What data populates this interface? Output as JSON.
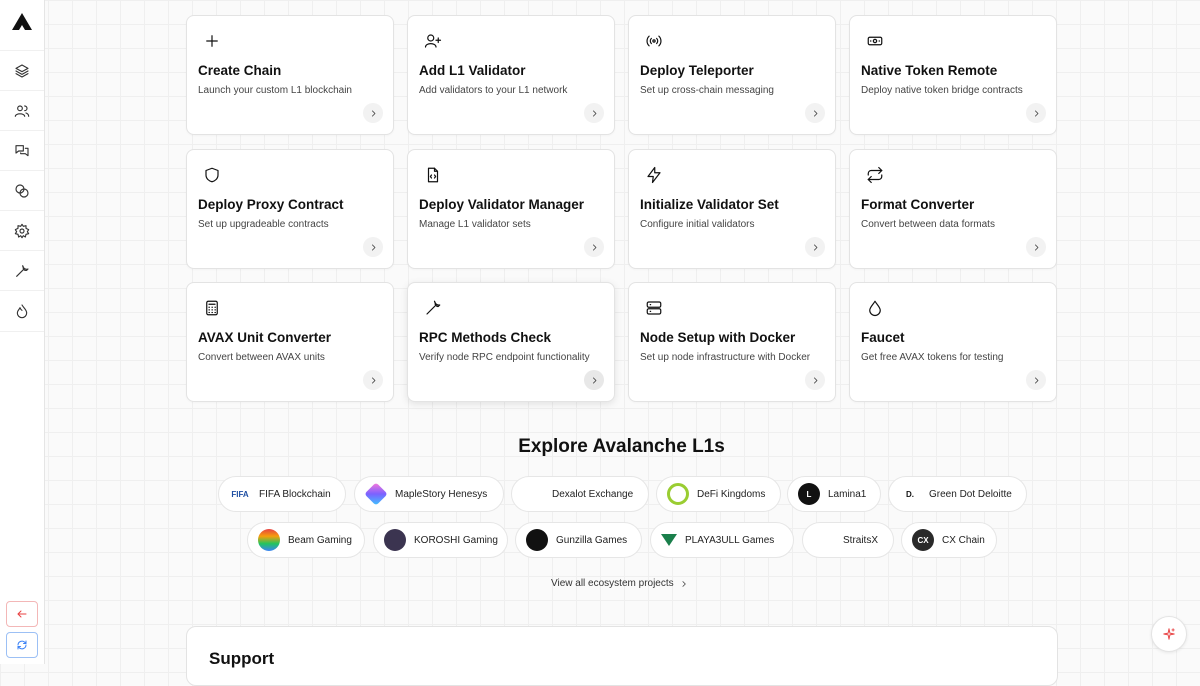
{
  "sidebar": {
    "logo_icon": "avalanche-logo",
    "items": [
      {
        "name": "layers-icon"
      },
      {
        "name": "users-icon"
      },
      {
        "name": "messages-icon"
      },
      {
        "name": "coins-icon"
      },
      {
        "name": "settings-gear-icon"
      },
      {
        "name": "wrench-icon"
      },
      {
        "name": "fire-icon"
      }
    ],
    "bottom_buttons": [
      {
        "name": "arrow-left-icon",
        "color": "#e84142"
      },
      {
        "name": "refresh-icon",
        "color": "#3b82f6"
      }
    ]
  },
  "tools": [
    {
      "title": "Create Chain",
      "desc": "Launch your custom L1 blockchain",
      "icon": "plus-icon"
    },
    {
      "title": "Add L1 Validator",
      "desc": "Add validators to your L1 network",
      "icon": "user-plus-icon"
    },
    {
      "title": "Deploy Teleporter",
      "desc": "Set up cross-chain messaging",
      "icon": "broadcast-icon"
    },
    {
      "title": "Native Token Remote",
      "desc": "Deploy native token bridge contracts",
      "icon": "banknote-icon"
    },
    {
      "title": "Deploy Proxy Contract",
      "desc": "Set up upgradeable contracts",
      "icon": "shield-icon"
    },
    {
      "title": "Deploy Validator Manager",
      "desc": "Manage L1 validator sets",
      "icon": "file-code-icon"
    },
    {
      "title": "Initialize Validator Set",
      "desc": "Configure initial validators",
      "icon": "lightning-icon"
    },
    {
      "title": "Format Converter",
      "desc": "Convert between data formats",
      "icon": "repeat-arrows-icon"
    },
    {
      "title": "AVAX Unit Converter",
      "desc": "Convert between AVAX units",
      "icon": "calculator-icon"
    },
    {
      "title": "RPC Methods Check",
      "desc": "Verify node RPC endpoint functionality",
      "icon": "wrench-icon"
    },
    {
      "title": "Node Setup with Docker",
      "desc": "Set up node infrastructure with Docker",
      "icon": "server-icon"
    },
    {
      "title": "Faucet",
      "desc": "Get free AVAX tokens for testing",
      "icon": "droplet-icon"
    }
  ],
  "explore": {
    "title": "Explore Avalanche L1s",
    "chains": [
      {
        "label": "FIFA Blockchain",
        "logo_text": "FIFA",
        "color": "#1f4fa3"
      },
      {
        "label": "MapleStory Henesys",
        "logo_text": "",
        "color": "#7b61ff"
      },
      {
        "label": "Dexalot Exchange",
        "logo_text": "",
        "color": "#d6336c"
      },
      {
        "label": "DeFi Kingdoms",
        "logo_text": "",
        "color": "#9acd32"
      },
      {
        "label": "Lamina1",
        "logo_text": "L",
        "color": "#111111"
      },
      {
        "label": "Green Dot Deloitte",
        "logo_text": "D.",
        "color": "#111111"
      },
      {
        "label": "Beam Gaming",
        "logo_text": "",
        "color": "#f59e0b"
      },
      {
        "label": "KOROSHI Gaming",
        "logo_text": "",
        "color": "#3b3450"
      },
      {
        "label": "Gunzilla Games",
        "logo_text": "",
        "color": "#111111"
      },
      {
        "label": "PLAYA3ULL Games",
        "logo_text": "",
        "color": "#1a7f4b"
      },
      {
        "label": "StraitsX",
        "logo_text": "",
        "color": "#2fbf71"
      },
      {
        "label": "CX Chain",
        "logo_text": "CX",
        "color": "#2a2a2a"
      }
    ],
    "view_all": "View all ecosystem projects"
  },
  "support": {
    "title": "Support"
  },
  "fab": {
    "icon": "sparkle-icon",
    "color": "#e84142"
  }
}
